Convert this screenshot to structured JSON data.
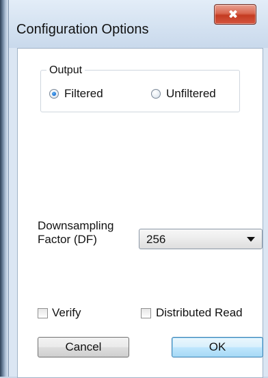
{
  "window": {
    "title": "Configuration Options"
  },
  "output_group": {
    "legend": "Output",
    "options": [
      {
        "label": "Filtered",
        "selected": true
      },
      {
        "label": "Unfiltered",
        "selected": false
      }
    ]
  },
  "downsampling": {
    "label_line1": "Downsampling",
    "label_line2": "Factor (DF)",
    "selected_value": "256"
  },
  "checkboxes": {
    "verify": {
      "label": "Verify",
      "checked": false
    },
    "distributed_read": {
      "label": "Distributed Read",
      "checked": false
    }
  },
  "buttons": {
    "cancel": "Cancel",
    "ok": "OK"
  },
  "icons": {
    "close": "close-icon",
    "dropdown": "chevron-down-icon"
  }
}
